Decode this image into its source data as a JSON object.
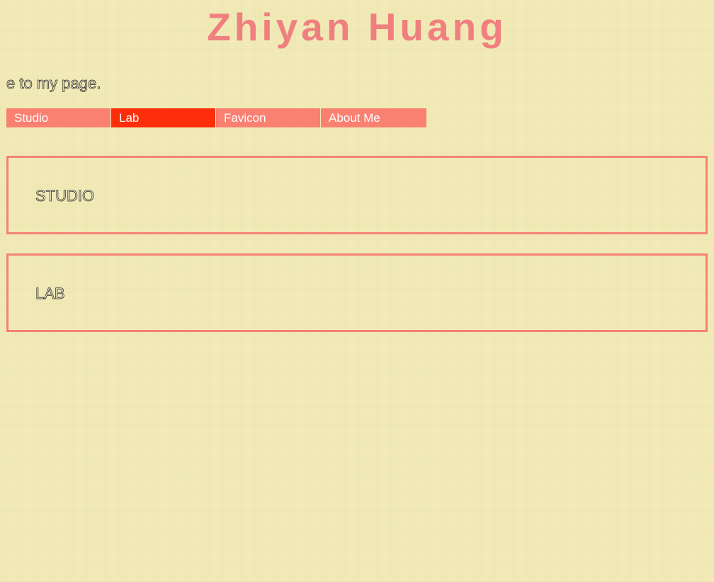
{
  "header": {
    "title": "Zhiyan Huang",
    "welcome_text": "e to my page."
  },
  "nav": {
    "items": [
      {
        "label": "Studio",
        "active": false
      },
      {
        "label": "Lab",
        "active": true
      },
      {
        "label": "Favicon",
        "active": false
      },
      {
        "label": "About Me",
        "active": false
      }
    ]
  },
  "sections": [
    {
      "heading": "STUDIO"
    },
    {
      "heading": "LAB"
    }
  ],
  "colors": {
    "background": "#f3ecb8",
    "title": "#f08080",
    "nav_default": "#fa8072",
    "nav_active": "#fe2e0a",
    "section_border": "#f58177"
  }
}
